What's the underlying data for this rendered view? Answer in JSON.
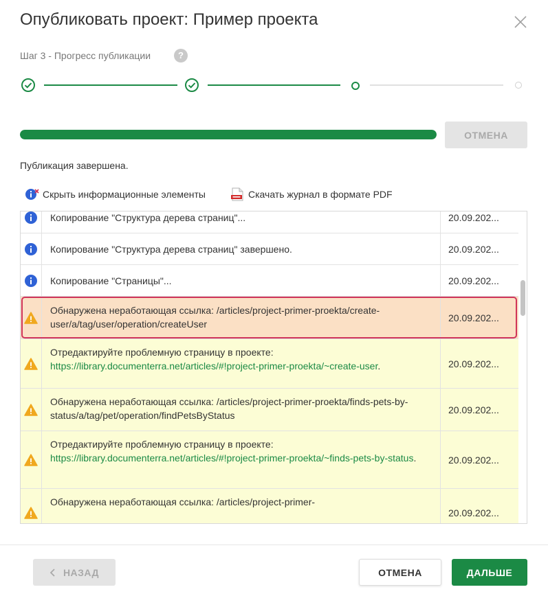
{
  "dialog": {
    "title": "Опубликовать проект: Пример проекта",
    "step_label": "Шаг 3 - Прогресс публикации",
    "help_glyph": "?"
  },
  "stepper": {
    "total_steps": 4,
    "current_step": 3
  },
  "progress": {
    "percent": 100,
    "cancel_label": "ОТМЕНА"
  },
  "status": "Публикация завершена.",
  "toolbar": {
    "hide_info_label": "Скрыть информационные элементы",
    "download_pdf_label": "Скачать журнал в формате PDF"
  },
  "log": {
    "rows": [
      {
        "type": "info",
        "message": "Копирование \"Структура дерева страниц\"...",
        "date": "20.09.202..."
      },
      {
        "type": "info",
        "message": "Копирование \"Структура дерева страниц\" завершено.",
        "date": "20.09.202..."
      },
      {
        "type": "info",
        "message": "Копирование \"Страницы\"...",
        "date": "20.09.202..."
      },
      {
        "type": "error",
        "message": "Обнаружена неработающая ссылка: /articles/project-primer-proekta/create-user/a/tag/user/operation/createUser",
        "date": "20.09.202..."
      },
      {
        "type": "warning",
        "message": "Отредактируйте проблемную страницу в проекте:",
        "link": "https://library.documenterra.net/articles/#!project-primer-proekta/~create-user",
        "suffix": ".",
        "date": "20.09.202..."
      },
      {
        "type": "warning",
        "message": "Обнаружена неработающая ссылка: /articles/project-primer-proekta/finds-pets-by-status/a/tag/pet/operation/findPetsByStatus",
        "date": "20.09.202..."
      },
      {
        "type": "warning",
        "message": "Отредактируйте проблемную страницу в проекте:",
        "link": "https://library.documenterra.net/articles/#!project-primer-proekta/~finds-pets-by-status",
        "suffix": ".",
        "date": "20.09.202..."
      },
      {
        "type": "warning",
        "message": "Обнаружена неработающая ссылка: /articles/project-primer-",
        "date": "20.09.202..."
      }
    ]
  },
  "footer": {
    "back_label": "НАЗАД",
    "cancel_label": "ОТМЕНА",
    "next_label": "ДАЛЬШЕ"
  },
  "colors": {
    "accent": "#1b8a45",
    "error_row": "#fbe0c5",
    "error_border": "#d0345a",
    "warning_row": "#fcfdd5",
    "warning_icon": "#f0a81e",
    "info_icon": "#2f62d6"
  }
}
